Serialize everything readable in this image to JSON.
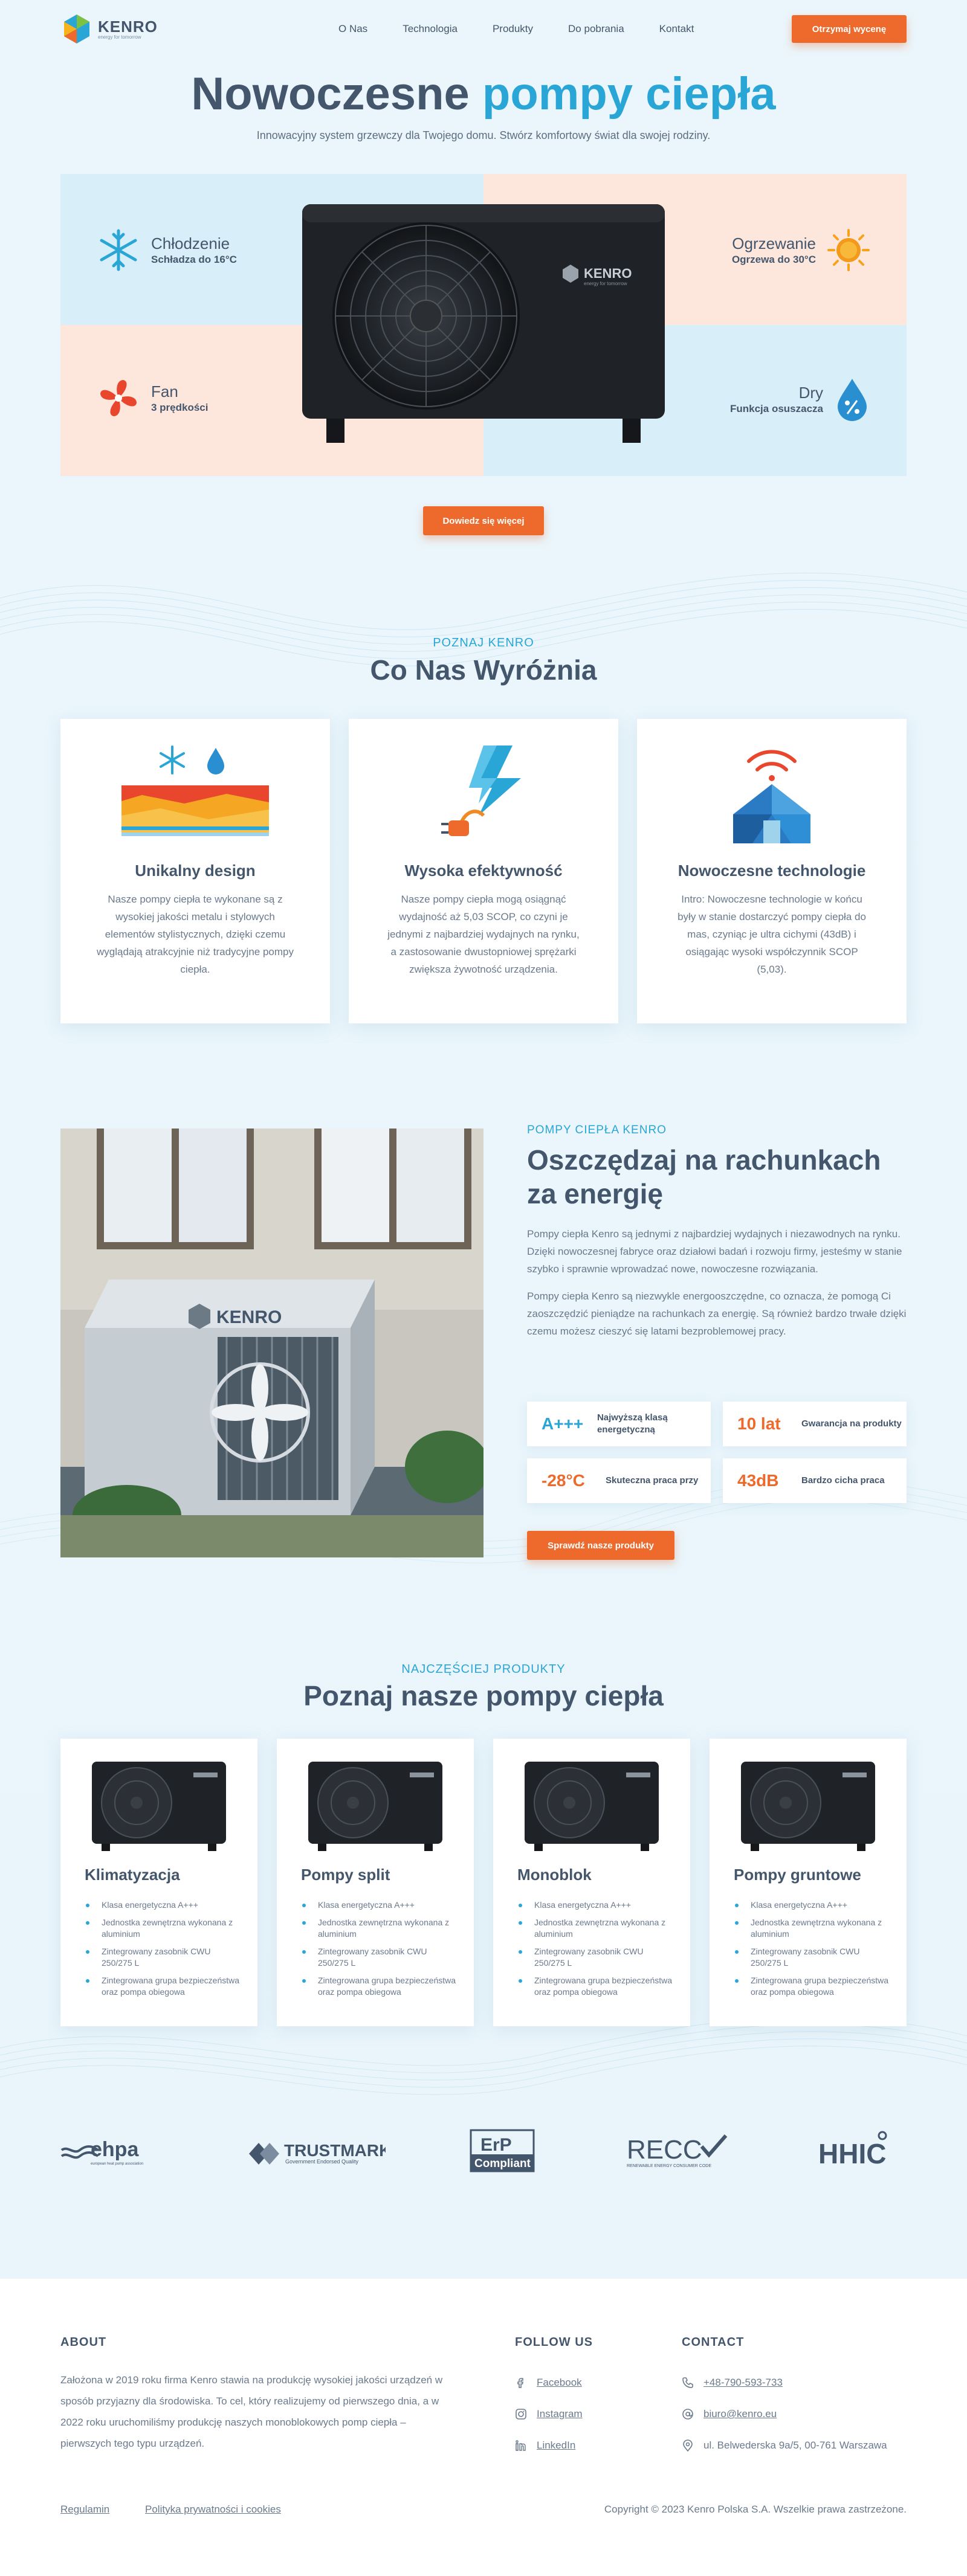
{
  "header": {
    "logo_text": "KENRO",
    "logo_tagline": "energy for tomorrow",
    "nav": [
      "O Nas",
      "Technologia",
      "Produkty",
      "Do pobrania",
      "Kontakt"
    ],
    "cta": "Otrzymaj wycenę"
  },
  "hero": {
    "title_main": "Nowoczesne",
    "title_accent": "pompy ciepła",
    "subtitle": "Innowacyjny system grzewczy dla Twojego domu. Stwórz komfortowy świat dla swojej rodziny.",
    "unit_brand": "KENRO",
    "unit_tagline": "energy for tomorrow",
    "features": [
      {
        "title": "Chłodzenie",
        "sub": "Schładza do 16°C",
        "icon": "snowflake-icon"
      },
      {
        "title": "Ogrzewanie",
        "sub": "Ogrzewa do 30°C",
        "icon": "sun-icon"
      },
      {
        "title": "Fan",
        "sub": "3 prędkości",
        "icon": "fan-icon"
      },
      {
        "title": "Dry",
        "sub": "Funkcja osuszacza",
        "icon": "water-drop-icon"
      }
    ],
    "cta": "Dowiedz się więcej"
  },
  "why": {
    "kicker": "POZNAJ KENRO",
    "title": "Co Nas Wyróżnia",
    "cards": [
      {
        "title": "Unikalny design",
        "text": "Nasze pompy ciepła te wykonane są z wysokiej jakości metalu i stylowych elementów stylistycznych, dzięki czemu wyglądają atrakcyjnie niż tradycyjne pompy ciepła.",
        "icon": "design-icon"
      },
      {
        "title": "Wysoka efektywność",
        "text": "Nasze pompy ciepła mogą osiągnąć wydajność aż 5,03 SCOP, co czyni je jednymi z najbardziej wydajnych na rynku, a zastosowanie dwustopniowej sprężarki zwiększa żywotność urządzenia.",
        "icon": "lightning-plug-icon"
      },
      {
        "title": "Nowoczesne technologie",
        "text": "Intro: Nowoczesne technologie w końcu były w stanie dostarczyć pompy ciepła do mas, czyniąc je ultra cichymi (43dB) i osiągając wysoki współczynnik SCOP (5,03).",
        "icon": "smart-home-icon"
      }
    ]
  },
  "about": {
    "kicker": "POMPY CIEPŁA KENRO",
    "title": "Oszczędzaj na rachunkach za energię",
    "p1": "Pompy ciepła Kenro są jednymi z najbardziej wydajnych i niezawodnych na rynku. Dzięki nowoczesnej fabryce oraz działowi badań i rozwoju firmy, jesteśmy w stanie szybko i sprawnie wprowadzać nowe, nowoczesne rozwiązania.",
    "p2": "Pompy ciepła Kenro są niezwykle energooszczędne, co oznacza, że pomogą Ci zaoszczędzić pieniądze na rachunkach za energię. Są również bardzo trwałe dzięki czemu możesz cieszyć się latami bezproblemowej pracy.",
    "stats": [
      {
        "value": "A+++",
        "label": "Najwyższą klasą energetyczną"
      },
      {
        "value": "10 lat",
        "label": "Gwarancja na produkty"
      },
      {
        "value": "-28°C",
        "label": "Skuteczna praca przy"
      },
      {
        "value": "43dB",
        "label": "Bardzo cicha praca"
      }
    ],
    "cta": "Sprawdź nasze produkty",
    "image_brand": "KENRO"
  },
  "products": {
    "kicker": "NAJCZĘŚCIEJ PRODUKTY",
    "title": "Poznaj nasze pompy ciepła",
    "items": [
      {
        "name": "Klimatyzacja",
        "features": [
          "Klasa energetyczna A+++",
          "Jednostka zewnętrzna wykonana z aluminium",
          "Zintegrowany zasobnik CWU 250/275 L",
          "Zintegrowana grupa bezpieczeństwa oraz pompa obiegowa"
        ]
      },
      {
        "name": "Pompy split",
        "features": [
          "Klasa energetyczna A+++",
          "Jednostka zewnętrzna wykonana z aluminium",
          "Zintegrowany zasobnik CWU 250/275 L",
          "Zintegrowana grupa bezpieczeństwa oraz pompa obiegowa"
        ]
      },
      {
        "name": "Monoblok",
        "features": [
          "Klasa energetyczna A+++",
          "Jednostka zewnętrzna wykonana z aluminium",
          "Zintegrowany zasobnik CWU 250/275 L",
          "Zintegrowana grupa bezpieczeństwa oraz pompa obiegowa"
        ]
      },
      {
        "name": "Pompy gruntowe",
        "features": [
          "Klasa energetyczna A+++",
          "Jednostka zewnętrzna wykonana z aluminium",
          "Zintegrowany zasobnik CWU 250/275 L",
          "Zintegrowana grupa bezpieczeństwa oraz pompa obiegowa"
        ]
      }
    ]
  },
  "partners": {
    "ehpa": "ehpa",
    "ehpa_sub": "european heat pump association",
    "trustmark": "TRUSTMARK",
    "trustmark_sub": "Government Endorsed Quality",
    "erp_top": "ErP",
    "erp_bottom": "Compliant",
    "recc": "RECC",
    "recc_sub": "RENEWABLE ENERGY CONSUMER CODE",
    "hhic": "HHIC"
  },
  "footer": {
    "about_title": "ABOUT",
    "about_text": "Założona w 2019 roku firma Kenro stawia na produkcję wysokiej jakości urządzeń w sposób przyjazny dla środowiska. To cel, który realizujemy od pierwszego dnia, a w 2022 roku uruchomiliśmy produkcję naszych monoblokowych pomp ciepła – pierwszych tego typu urządzeń.",
    "follow_title": "FOLLOW US",
    "social": [
      "Facebook",
      "Instagram",
      "LinkedIn"
    ],
    "contact_title": "CONTACT",
    "phone": "+48-790-593-733",
    "email": "biuro@kenro.eu",
    "address": "ul. Belwederska 9a/5, 00-761 Warszawa",
    "links": [
      "Regulamin",
      "Polityka prywatności i cookies"
    ],
    "copyright": "Copyright © 2023 Kenro Polska S.A. Wszelkie prawa zastrzeżone."
  },
  "colors": {
    "accent": "#2aa6d6",
    "cta": "#ee6a2c",
    "text": "#44566c",
    "bg": "#eaf6fc"
  }
}
